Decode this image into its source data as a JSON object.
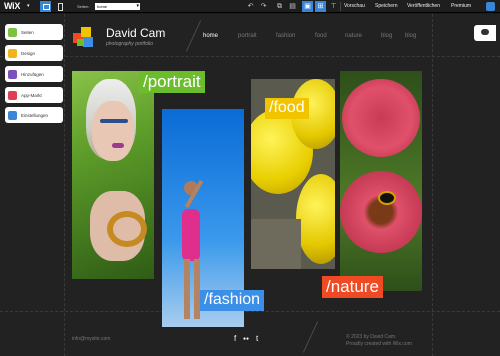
{
  "editor": {
    "logo": "WiX",
    "pages_label": "Seiten:",
    "page_selected": "home",
    "buttons": [
      "Vorschau",
      "Speichern",
      "Veröffentlichen",
      "Premium"
    ]
  },
  "side_panel": {
    "items": [
      {
        "label": "Seiten",
        "color": "#7cc242"
      },
      {
        "label": "Design",
        "color": "#f3b41b"
      },
      {
        "label": "Hinzufügen",
        "color": "#7b4fbd"
      },
      {
        "label": "App-Markt",
        "color": "#e03e52"
      },
      {
        "label": "Einstellungen",
        "color": "#3a86d6"
      }
    ]
  },
  "site": {
    "brand_name": "David Cam",
    "brand_sub": "photography portfolio",
    "nav": [
      "home",
      "portrait",
      "fashion",
      "food",
      "nature",
      "blog",
      "blog"
    ],
    "nav_active": 0,
    "galleries": {
      "portrait": "/portrait",
      "fashion": "/fashion",
      "food": "/food",
      "nature": "/nature"
    },
    "label_colors": {
      "portrait": "#6bbd2b",
      "fashion": "#3c8fe6",
      "food": "#f2c400",
      "nature": "#ef4a23"
    },
    "footer": {
      "email": "info@mysite.com",
      "copyright_line1": "© 2023 by David Cam.",
      "copyright_line2": "Proudly created with Wix.com"
    },
    "social": [
      "f",
      "●●",
      "t"
    ]
  }
}
